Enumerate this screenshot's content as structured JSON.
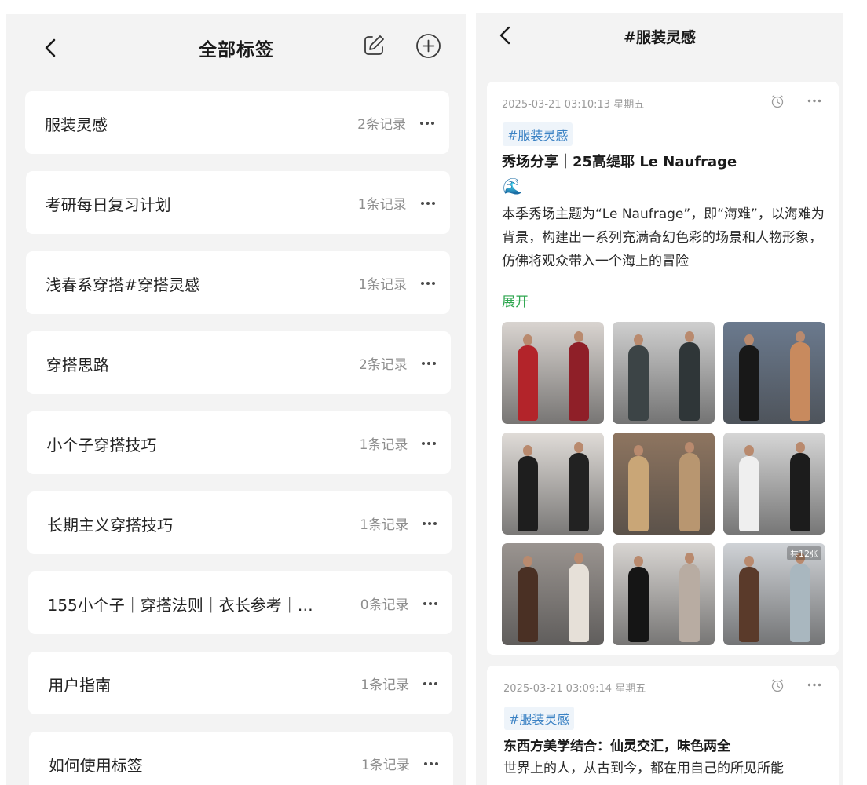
{
  "left": {
    "title": "全部标签",
    "tags": [
      {
        "name": "服装灵感",
        "count": "2条记录"
      },
      {
        "name": "考研每日复习计划",
        "count": "1条记录"
      },
      {
        "name": "浅春系穿搭#穿搭灵感",
        "count": "1条记录"
      },
      {
        "name": "穿搭思路",
        "count": "2条记录"
      },
      {
        "name": "小个子穿搭技巧",
        "count": "1条记录"
      },
      {
        "name": "长期主义穿搭技巧",
        "count": "1条记录"
      },
      {
        "name": "155小个子｜穿搭法则｜衣长参考｜…",
        "count": "0条记录"
      },
      {
        "name": "用户指南",
        "count": "1条记录"
      },
      {
        "name": "如何使用标签",
        "count": "1条记录"
      }
    ]
  },
  "right": {
    "title": "#服装灵感",
    "notes": [
      {
        "date": "2025-03-21 03:10:13 星期五",
        "tag": "#服装灵感",
        "title": "秀场分享｜25高缇耶 Le Naufrage",
        "emoji": "🌊",
        "body": "本季秀场主题为“Le Naufrage”，即“海难”，以海难为背景，构建出一系列充满奇幻色彩的场景和人物形象，仿佛将观众带入一个海上的冒险",
        "expand": "展开",
        "photo_count": "共12张",
        "photos": [
          {
            "bg": "#d9d4d0",
            "figs": [
              "#b3242a",
              "#8f1f28"
            ]
          },
          {
            "bg": "#cfcfcf",
            "figs": [
              "#3c4446",
              "#2f3638"
            ]
          },
          {
            "bg": "#6b7a8e",
            "figs": [
              "#181818",
              "#c88a5e"
            ]
          },
          {
            "bg": "#e0dcd8",
            "figs": [
              "#1e1e1e",
              "#222222"
            ]
          },
          {
            "bg": "#8e7560",
            "figs": [
              "#c9a677",
              "#b89670"
            ]
          },
          {
            "bg": "#d6d6d6",
            "figs": [
              "#efefef",
              "#1c1c1c"
            ]
          },
          {
            "bg": "#9a9490",
            "figs": [
              "#4a3024",
              "#e6e0d8"
            ]
          },
          {
            "bg": "#d8d5d2",
            "figs": [
              "#151515",
              "#b8aca2"
            ]
          },
          {
            "bg": "#cfd2d6",
            "figs": [
              "#5a3a2a",
              "#a9b7bf"
            ]
          }
        ]
      },
      {
        "date": "2025-03-21 03:09:14 星期五",
        "tag": "#服装灵感",
        "title": "东西方美学结合：仙灵交汇，味色两全",
        "body": "世界上的人，从古到今，都在用自己的所见所能"
      }
    ]
  },
  "colors": {
    "background": "#f3f3f3",
    "card": "#ffffff",
    "tag_chip_text": "#3b82c4",
    "expand_green": "#2ea64f",
    "muted_text": "#8e8e8e"
  },
  "icons": [
    "back-arrow-icon",
    "edit-icon",
    "add-circle-icon",
    "more-dots-icon",
    "alarm-clock-icon",
    "wave-emoji-icon"
  ]
}
